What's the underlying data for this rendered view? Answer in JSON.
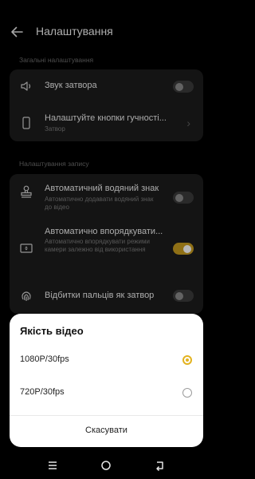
{
  "header": {
    "title": "Налаштування"
  },
  "general": {
    "section_label": "Загальні налаштування",
    "shutter_sound": {
      "label": "Звук затвора",
      "enabled": false
    },
    "volume_buttons": {
      "label": "Налаштуйте кнопки гучності...",
      "value": "Затвор"
    }
  },
  "recording": {
    "section_label": "Налаштування запису",
    "watermark": {
      "label": "Автоматичний водяний знак",
      "description": "Автоматично додавати водяний знак до відео",
      "enabled": false
    },
    "auto_arrange": {
      "label": "Автоматично впорядкувати...",
      "description": "Автоматично впорядкувати режими камери залежно від використання",
      "enabled": true
    },
    "fingerprint": {
      "label": "Відбитки пальців як затвор",
      "enabled": false
    }
  },
  "sheet": {
    "title": "Якість відео",
    "options": [
      {
        "label": "1080P/30fps",
        "selected": true
      },
      {
        "label": "720P/30fps",
        "selected": false
      }
    ],
    "cancel_label": "Скасувати"
  },
  "colors": {
    "accent": "#e3b320",
    "toggle_on": "#c79b1f",
    "card": "#1d1d1d",
    "background": "#000000"
  },
  "icons": [
    "back-arrow-icon",
    "speaker-icon",
    "phone-icon",
    "stamp-icon",
    "arrange-icon",
    "fingerprint-icon",
    "menu-icon",
    "home-icon",
    "back-icon"
  ]
}
